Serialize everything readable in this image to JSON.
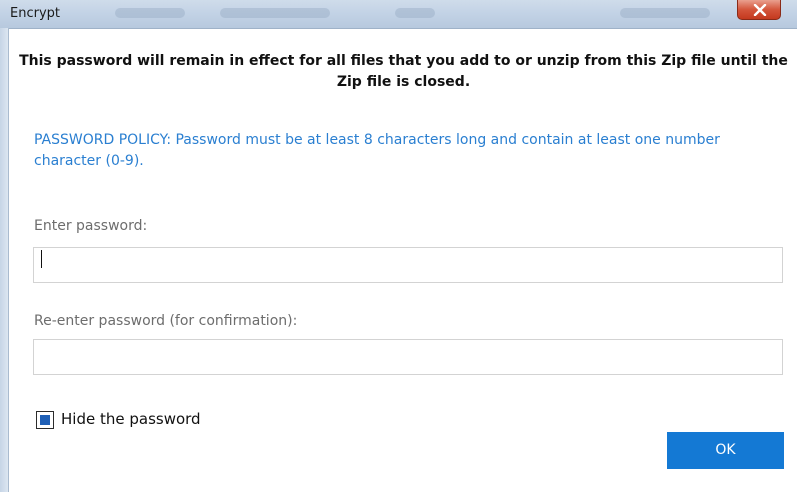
{
  "window": {
    "title": "Encrypt",
    "close_symbol": "x"
  },
  "dialog": {
    "notice": "This password will remain in effect for all files that you add to or unzip from this Zip file until the Zip file is closed.",
    "policy": "PASSWORD POLICY: Password must be at least 8 characters long and contain at least one number character (0-9).",
    "password_label": "Enter password:",
    "password_value": "",
    "confirm_label": "Re-enter password (for confirmation):",
    "confirm_value": "",
    "hide_password_label": "Hide the password",
    "hide_password_checked": true,
    "ok_label": "OK"
  },
  "colors": {
    "policy_text": "#2a7fd1",
    "ok_button": "#1479d4",
    "checkbox_fill": "#1e5fb6",
    "close_button": "#d4553b"
  },
  "icons": {
    "close": "close-icon",
    "caret": "text-caret"
  }
}
